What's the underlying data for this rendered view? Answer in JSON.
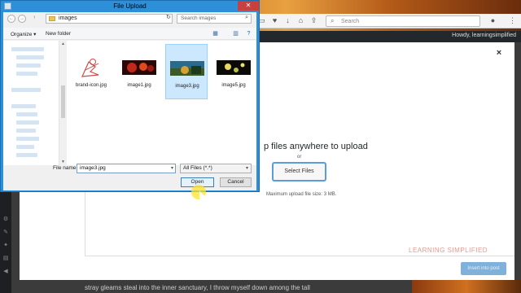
{
  "browser": {
    "search_placeholder": "Search",
    "admin_bar_greeting": "Howdy, learningsimplified"
  },
  "media_modal": {
    "drop_title": "p files anywhere to upload",
    "or_text": "or",
    "select_files_label": "Select Files",
    "max_size_text": "Maximum upload file size: 3 MB.",
    "watermark": "LEARNING SIMPLIFIED",
    "insert_button_label": "Insert into post",
    "close_glyph": "×"
  },
  "page_text": "stray gleams steal into the inner sanctuary, I throw myself down among the tall",
  "dialog": {
    "title": "File Upload",
    "close_glyph": "✕",
    "address_path": "images",
    "search_placeholder": "Search images",
    "organize_label": "Organize ▾",
    "new_folder_label": "New folder",
    "files": [
      {
        "name": "brand-icon.jpg",
        "selected": false
      },
      {
        "name": "image1.jpg",
        "selected": false
      },
      {
        "name": "image3.jpg",
        "selected": true
      },
      {
        "name": "image5.jpg",
        "selected": false
      }
    ],
    "file_name_label": "File name:",
    "file_name_value": "image3.jpg",
    "file_type_value": "All Files (*.*)",
    "open_label": "Open",
    "cancel_label": "Cancel"
  },
  "colors": {
    "dialog_titlebar": "#2d8fd8",
    "selection": "#cce8ff",
    "insert_button": "#7fb1db",
    "watermark": "#e8988a"
  }
}
